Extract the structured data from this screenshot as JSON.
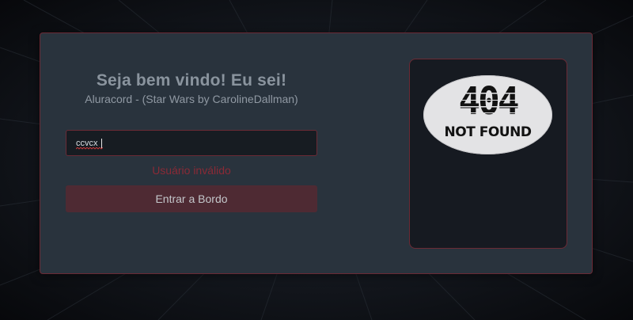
{
  "login": {
    "title": "Seja bem vindo! Eu sei!",
    "subtitle": "Aluracord - (Star Wars by CarolineDallman)",
    "username_value": "ccvcx",
    "error_message": "Usuário inválido",
    "submit_label": "Entrar a Bordo"
  },
  "profile_panel": {
    "image_title": "404",
    "image_subtitle": "NOT FOUND"
  },
  "colors": {
    "accent_border": "#6b2a35",
    "button_bg": "#4e2a33",
    "error_text": "#8a2a36",
    "card_bg": "#29333d",
    "panel_bg": "#161a21"
  }
}
